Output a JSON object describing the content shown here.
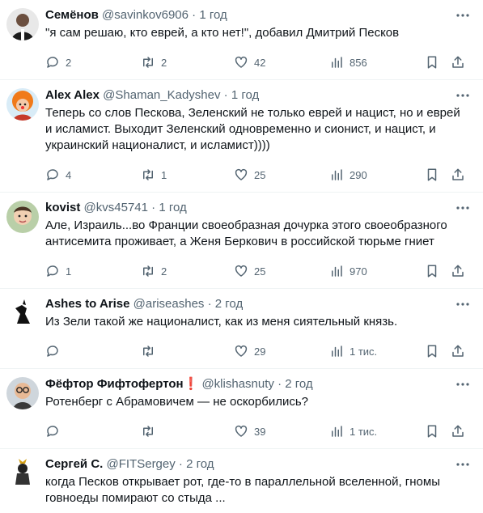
{
  "tweets": [
    {
      "name": "Семёнов",
      "handle": "@savinkov6906",
      "dot": "·",
      "time": "1 год",
      "lines": [
        "\"я сам решаю, кто  еврей, а кто нет!\", добавил Дмитрий Песков"
      ],
      "replies": "2",
      "retweets": "2",
      "likes": "42",
      "views": "856"
    },
    {
      "name": "Alex Alex",
      "handle": "@Shaman_Kadyshev",
      "dot": "·",
      "time": "1 год",
      "lines": [
        "Теперь со слов Пескова, Зеленский не только еврей и нацист, но и еврей",
        "и исламист. Выходит Зеленский одновременно и сионист, и нацист, и",
        "украинский националист, и исламист))))"
      ],
      "replies": "4",
      "retweets": "1",
      "likes": "25",
      "views": "290"
    },
    {
      "name": "kovist",
      "handle": "@kvs45741",
      "dot": "·",
      "time": "1 год",
      "lines": [
        "Але, Израиль...во Франции своеобразная дочурка этого своеобразного",
        "антисемита проживает, а Женя Беркович в российской тюрьме гниет"
      ],
      "replies": "1",
      "retweets": "2",
      "likes": "25",
      "views": "970"
    },
    {
      "name": "Ashes to Arise",
      "handle": "@ariseashes",
      "dot": "·",
      "time": "2 год",
      "lines": [
        "Из Зели такой же националист, как из меня сиятельный князь."
      ],
      "replies": "",
      "retweets": "",
      "likes": "29",
      "views": "1 тис."
    },
    {
      "name": "Фёфтор Фифтофертон",
      "badge": "❗",
      "handle": "@klishasnuty",
      "dot": "·",
      "time": "2 год",
      "lines": [
        "Ротенберг с Абрамовичем — не оскорбились?"
      ],
      "replies": "",
      "retweets": "",
      "likes": "39",
      "views": "1 тис."
    },
    {
      "name": "Сергей С.",
      "handle": "@FITSergey",
      "dot": "·",
      "time": "2 год",
      "lines": [
        "когда Песков открывает рот, где-то в  параллельной вселенной, гномы",
        "говноеды помирают со стыда ..."
      ]
    }
  ],
  "colors": {
    "text": "#0f1419",
    "secondary": "#536471",
    "divider": "#eff3f4",
    "badge": "#f4212e"
  }
}
